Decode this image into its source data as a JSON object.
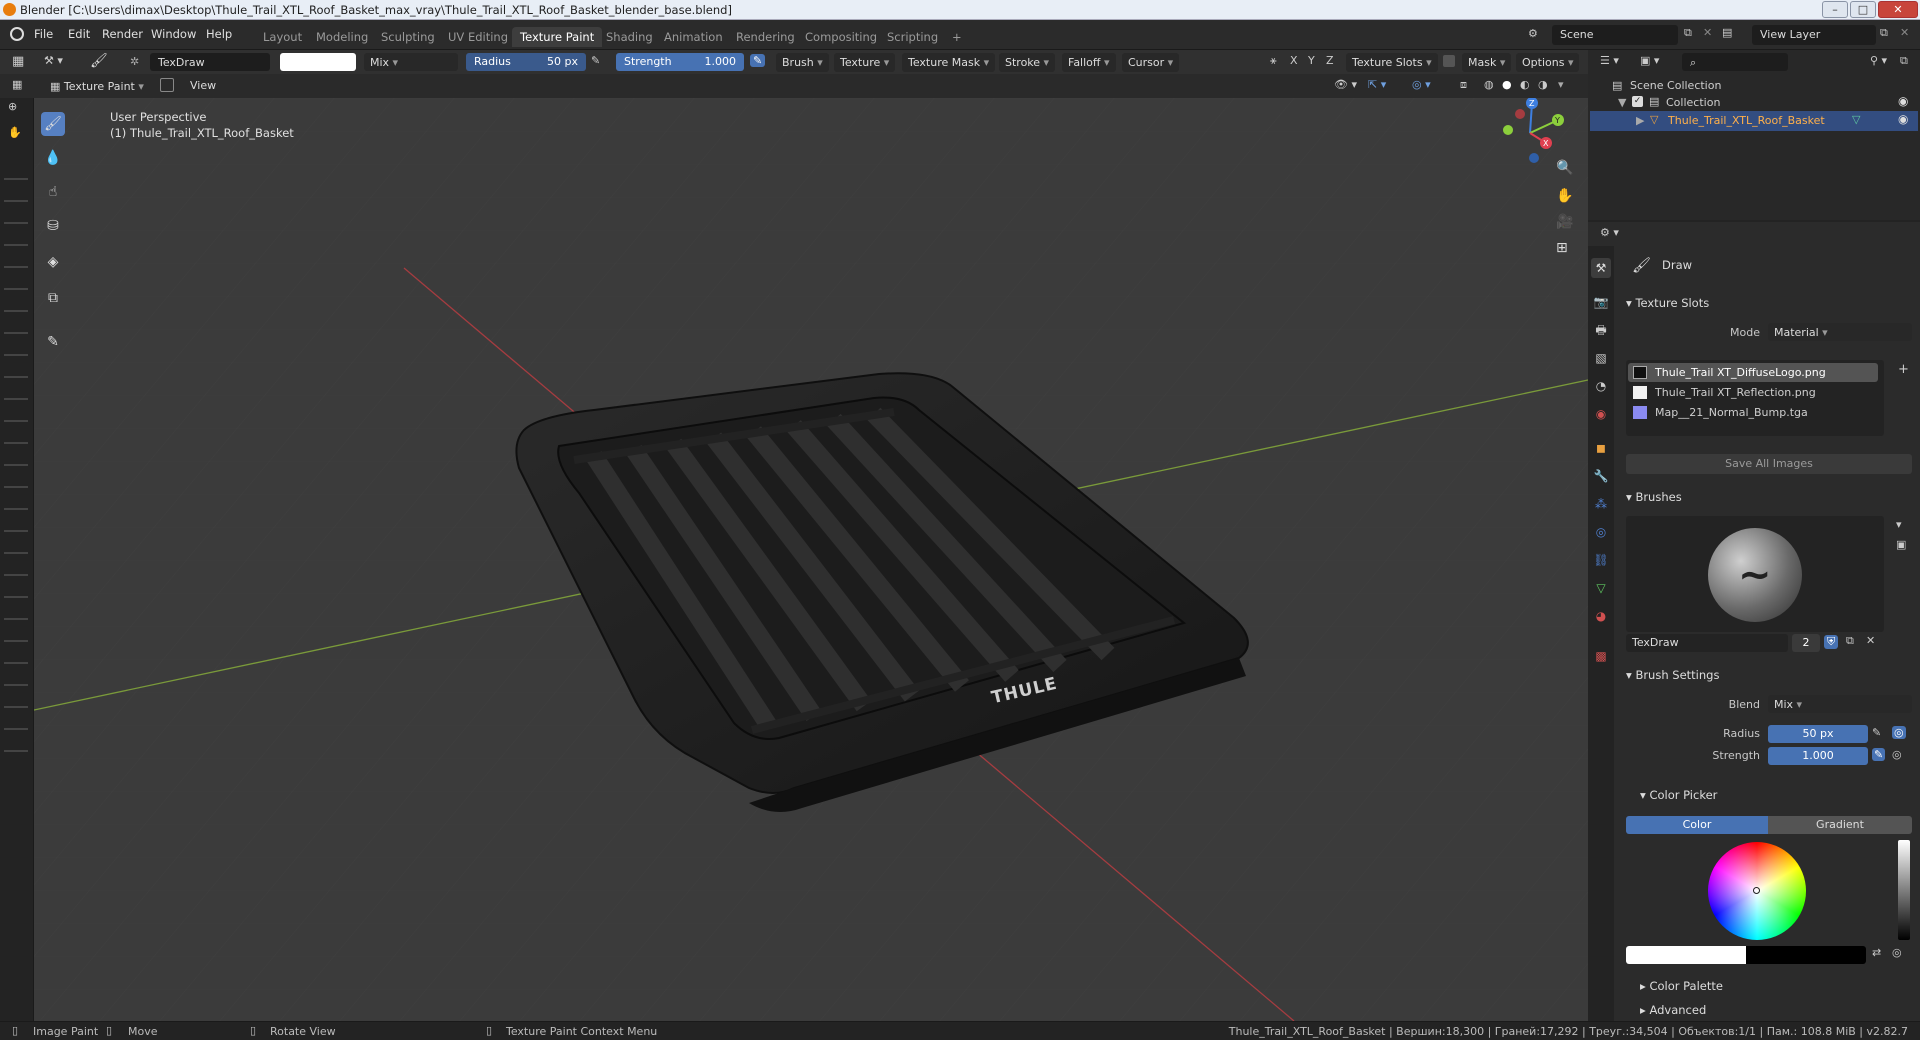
{
  "window": {
    "title": "Blender [C:\\Users\\dimax\\Desktop\\Thule_Trail_XTL_Roof_Basket_max_vray\\Thule_Trail_XTL_Roof_Basket_blender_base.blend]"
  },
  "menu": [
    "File",
    "Edit",
    "Render",
    "Window",
    "Help"
  ],
  "workspaces": [
    "Layout",
    "Modeling",
    "Sculpting",
    "UV Editing",
    "Texture Paint",
    "Shading",
    "Animation",
    "Rendering",
    "Compositing",
    "Scripting",
    "+"
  ],
  "scene": {
    "scene_label": "Scene",
    "view_layer_label": "View Layer"
  },
  "toolheader": {
    "brush_name": "TexDraw",
    "blend": "Mix",
    "radius_label": "Radius",
    "radius_value": "50 px",
    "strength_label": "Strength",
    "strength_value": "1.000",
    "brush": "Brush",
    "texture": "Texture",
    "texture_mask": "Texture Mask",
    "stroke": "Stroke",
    "falloff": "Falloff",
    "cursor": "Cursor",
    "x": "X",
    "y": "Y",
    "z": "Z",
    "texture_slots": "Texture Slots",
    "mask": "Mask",
    "options": "Options"
  },
  "viewheader": {
    "mode": "Texture Paint",
    "view": "View"
  },
  "viewport": {
    "perspective": "User Perspective",
    "object": "(1) Thule_Trail_XTL_Roof_Basket",
    "logo": "THULE"
  },
  "outliner": {
    "scene_collection": "Scene Collection",
    "collection": "Collection",
    "object": "Thule_Trail_XTL_Roof_Basket"
  },
  "properties": {
    "tool_name": "Draw",
    "texture_slots": {
      "title": "Texture Slots",
      "mode_label": "Mode",
      "mode_value": "Material",
      "items": [
        "Thule_Trail XT_DiffuseLogo.png",
        "Thule_Trail XT_Reflection.png",
        "Map__21_Normal_Bump.tga"
      ],
      "save_all": "Save All Images"
    },
    "brushes": {
      "title": "Brushes",
      "name": "TexDraw",
      "users": "2"
    },
    "brush_settings": {
      "title": "Brush Settings",
      "blend_label": "Blend",
      "blend_value": "Mix",
      "radius_label": "Radius",
      "radius_value": "50 px",
      "strength_label": "Strength",
      "strength_value": "1.000"
    },
    "color_picker": {
      "title": "Color Picker",
      "tab_color": "Color",
      "tab_gradient": "Gradient"
    },
    "color_palette": "Color Palette",
    "advanced": "Advanced"
  },
  "statusbar": {
    "left1": "Image Paint",
    "left2": "Move",
    "left3": "Rotate View",
    "left4": "Texture Paint Context Menu",
    "stats": "Thule_Trail_XTL_Roof_Basket | Вершин:18,300 | Граней:17,292 | Треуг.:34,504 | Объектов:1/1 | Пам.: 108.8 MiB | v2.82.7"
  },
  "colors": {
    "accent": "#4772b3",
    "active_tool": "#5680c2",
    "axis_x": "#e04050",
    "axis_y": "#8ccf3c",
    "axis_z": "#3e7fe0"
  }
}
